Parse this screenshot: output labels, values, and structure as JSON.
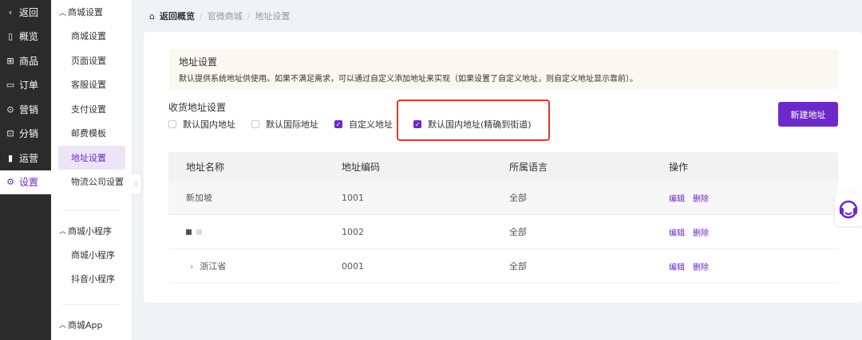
{
  "nav": {
    "items": [
      {
        "icon": "back-arrow-icon",
        "glyph": "‹",
        "label": "返回"
      },
      {
        "icon": "overview-icon",
        "glyph": "▯",
        "label": "概览"
      },
      {
        "icon": "goods-icon",
        "glyph": "⊞",
        "label": "商品"
      },
      {
        "icon": "order-icon",
        "glyph": "▭",
        "label": "订单"
      },
      {
        "icon": "marketing-icon",
        "glyph": "⊙",
        "label": "营销"
      },
      {
        "icon": "distribution-icon",
        "glyph": "⊡",
        "label": "分销"
      },
      {
        "icon": "operation-icon",
        "glyph": "▮",
        "label": "运营"
      },
      {
        "icon": "settings-icon",
        "glyph": "⚙",
        "label": "设置"
      }
    ]
  },
  "subnav": {
    "group1": "商城设置",
    "items1": [
      "商城设置",
      "页面设置",
      "客服设置",
      "支付设置",
      "邮费模板",
      "地址设置",
      "物流公司设置"
    ],
    "group2": "商城小程序",
    "items2": [
      "商城小程序",
      "抖音小程序"
    ],
    "group3": "商城App"
  },
  "breadcrumb": {
    "home": "返回概览",
    "sep": "/",
    "level1": "官微商城",
    "level2": "地址设置"
  },
  "notice": {
    "title": "地址设置",
    "desc": "默认提供系统地址供使用。如果不满足需求，可以通过自定义添加地址来实现（如果设置了自定义地址，则自定义地址显示靠前）。"
  },
  "receive": {
    "title": "收货地址设置",
    "options": [
      {
        "label": "默认国内地址",
        "checked": false
      },
      {
        "label": "默认国际地址",
        "checked": false
      },
      {
        "label": "自定义地址",
        "checked": true
      },
      {
        "label": "默认国内地址(精确到街道)",
        "checked": true
      }
    ]
  },
  "new_button": "新建地址",
  "table": {
    "headers": [
      "地址名称",
      "地址编码",
      "所属语言",
      "操作"
    ],
    "rows": [
      {
        "name": "新加坡",
        "code": "1001",
        "lang": "全部"
      },
      {
        "name": "",
        "code": "1002",
        "lang": "全部"
      },
      {
        "name": "浙江省",
        "code": "0001",
        "lang": "全部"
      }
    ],
    "edit": "编辑",
    "delete": "删除",
    "expand_glyph": "›"
  },
  "colors": {
    "accent": "#6d28c9",
    "nav_bg": "#2b2b2b",
    "highlight": "#e0382e"
  }
}
